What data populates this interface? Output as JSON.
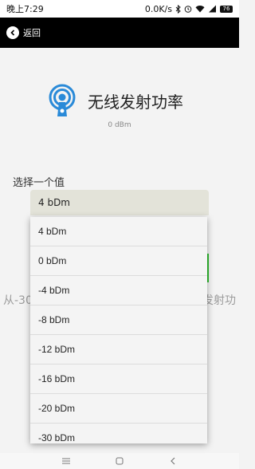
{
  "status": {
    "time": "晚上7:29",
    "net_speed": "0.0K/s",
    "battery": "76"
  },
  "app_bar": {
    "back_label": "返回"
  },
  "header": {
    "title": "无线发射功率",
    "subtitle": "0 dBm"
  },
  "selector": {
    "label": "选择一个值",
    "selected": "4 bDm",
    "options": [
      "4 bDm",
      "0 bDm",
      "-4 bDm",
      "-8 bDm",
      "-12 bDm",
      "-16 bDm",
      "-20 bDm",
      "-30 bDm"
    ]
  },
  "background": {
    "left_text": "从-30",
    "right_text": "发射功"
  },
  "colors": {
    "accent_green": "#2fbf2f",
    "icon_blue": "#2a8ad8"
  }
}
